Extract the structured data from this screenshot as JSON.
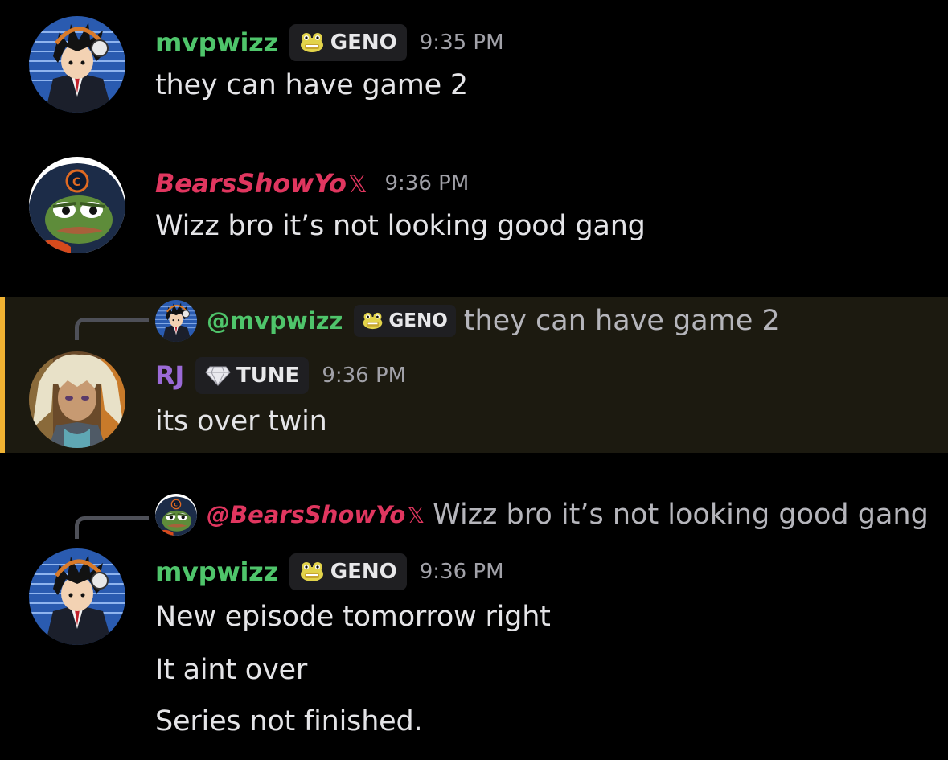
{
  "colors": {
    "mvpwizz": "#4fc56b",
    "bears": "#e0365f",
    "rj": "#9b6ad6",
    "highlight_bar": "#f0b232"
  },
  "messages": [
    {
      "username": "mvpwizz",
      "tag": "GENO",
      "tag_icon": "frog-icon",
      "time": "9:35 PM",
      "lines": [
        "they can have game 2"
      ]
    },
    {
      "username": "BearsShowYo",
      "suffix": "𝕏",
      "time": "9:36 PM",
      "lines": [
        "Wizz bro it’s not looking good gang"
      ]
    },
    {
      "reply": {
        "name": "@mvpwizz",
        "tag": "GENO",
        "text": "they can have game 2"
      },
      "username": "RJ",
      "tag": "TUNE",
      "tag_icon": "diamond-icon",
      "time": "9:36 PM",
      "lines": [
        "its over twin"
      ]
    },
    {
      "reply": {
        "name": "@BearsShowYo",
        "suffix": "𝕏",
        "text": "Wizz bro it’s not looking good gang"
      },
      "username": "mvpwizz",
      "tag": "GENO",
      "tag_icon": "frog-icon",
      "time": "9:36 PM",
      "lines": [
        "New episode tomorrow right",
        "It aint over",
        "Series not finished."
      ]
    }
  ]
}
